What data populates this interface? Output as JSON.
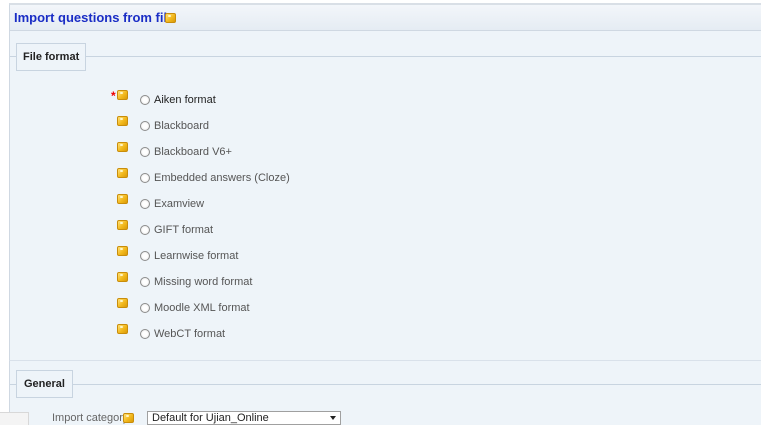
{
  "page": {
    "title": "Import questions from file"
  },
  "file_format": {
    "legend": "File format",
    "required_marker": "*",
    "options": [
      {
        "label": "Aiken format"
      },
      {
        "label": "Blackboard"
      },
      {
        "label": "Blackboard V6+"
      },
      {
        "label": "Embedded answers (Cloze)"
      },
      {
        "label": "Examview"
      },
      {
        "label": "GIFT format"
      },
      {
        "label": "Learnwise format"
      },
      {
        "label": "Missing word format"
      },
      {
        "label": "Moodle XML format"
      },
      {
        "label": "WebCT format"
      }
    ]
  },
  "general": {
    "legend": "General",
    "import_category_label": "Import category",
    "import_category_value": "Default for Ujian_Online"
  },
  "icons": {
    "help": "help-icon",
    "dropdown": "chevron-down-icon"
  },
  "colors": {
    "title": "#1a2dc5",
    "required": "#ee0000",
    "panel_bg": "#eef4f9"
  }
}
